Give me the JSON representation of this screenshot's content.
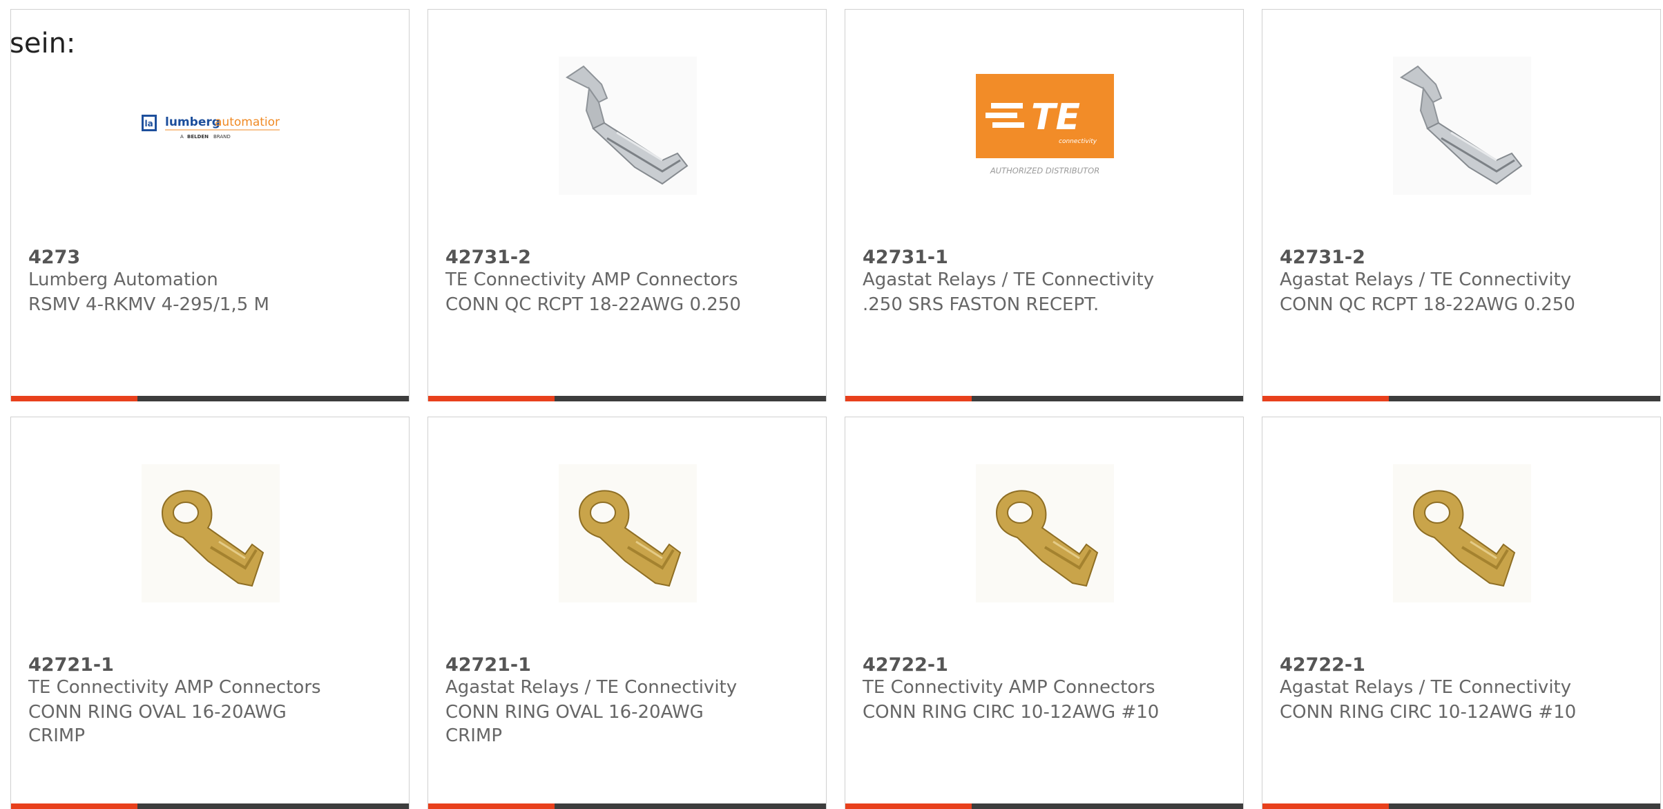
{
  "page": {
    "fragment_text": "sein:"
  },
  "products": [
    {
      "part": "4273",
      "manufacturer": "Lumberg Automation",
      "description": "RSMV 4-RKMV 4-295/1,5 M",
      "image": "lumberg-logo",
      "logo": {
        "mark": "la",
        "name_a": "lumberg",
        "name_b": "automation",
        "tagline_a": "A",
        "tagline_b": "BELDEN",
        "tagline_c": "BRAND"
      }
    },
    {
      "part": "42731-2",
      "manufacturer": "TE Connectivity AMP Connectors",
      "description": "CONN QC RCPT 18-22AWG 0.250",
      "image": "faston-receptacle"
    },
    {
      "part": "42731-1",
      "manufacturer": "Agastat Relays / TE Connectivity",
      "description": ".250 SRS FASTON RECEPT.",
      "image": "te-logo",
      "logo": {
        "letters": "TE",
        "subtitle": "connectivity",
        "caption": "AUTHORIZED DISTRIBUTOR"
      }
    },
    {
      "part": "42731-2",
      "manufacturer": "Agastat Relays / TE Connectivity",
      "description": "CONN QC RCPT 18-22AWG 0.250",
      "image": "faston-receptacle"
    },
    {
      "part": "42721-1",
      "manufacturer": "TE Connectivity AMP Connectors",
      "description": "CONN RING OVAL 16-20AWG CRIMP",
      "image": "ring-terminal"
    },
    {
      "part": "42721-1",
      "manufacturer": "Agastat Relays / TE Connectivity",
      "description": "CONN RING OVAL 16-20AWG CRIMP",
      "image": "ring-terminal"
    },
    {
      "part": "42722-1",
      "manufacturer": "TE Connectivity AMP Connectors",
      "description": "CONN RING CIRC 10-12AWG #10",
      "image": "ring-terminal"
    },
    {
      "part": "42722-1",
      "manufacturer": "Agastat Relays / TE Connectivity",
      "description": "CONN RING CIRC 10-12AWG #10",
      "image": "ring-terminal"
    }
  ],
  "colors": {
    "accent": "#e8401c",
    "bar": "#3d3d3d",
    "te_orange": "#f28c28",
    "lumberg_blue": "#1d4f9c",
    "brass": "#c9a44a",
    "steel": "#b8bcc0"
  }
}
